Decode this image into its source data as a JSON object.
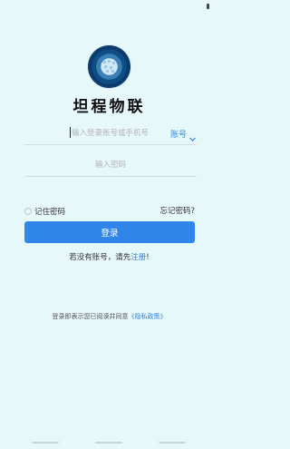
{
  "app": {
    "title": "坦程物联"
  },
  "account_field": {
    "placeholder": "输入登录账号或手机号",
    "value": ""
  },
  "account_type": {
    "label": "账号"
  },
  "password_field": {
    "placeholder": "输入密码",
    "value": ""
  },
  "remember": {
    "label": "记住密码",
    "checked": false
  },
  "forgot": {
    "label": "忘记密码?"
  },
  "login_button": {
    "label": "登录"
  },
  "register": {
    "prefix": "若没有账号，请先",
    "link": "注册",
    "suffix": "!"
  },
  "agreement": {
    "prefix": "登录即表示您已阅读并同意",
    "link": "《隐私政策》"
  },
  "icons": {
    "logo": "globe-logo-icon",
    "chevron": "chevron-down-icon",
    "checkbox": "checkbox-icon"
  },
  "colors": {
    "accent": "#2f86e8",
    "background": "#e7f8fb"
  }
}
